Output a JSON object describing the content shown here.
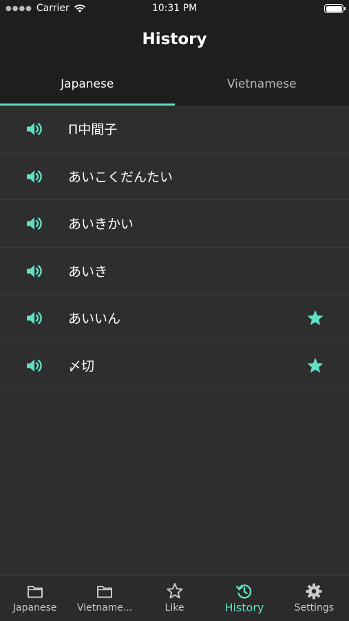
{
  "status_bar": {
    "carrier": "Carrier",
    "time": "10:31 PM"
  },
  "nav": {
    "title": "History"
  },
  "top_tabs": [
    {
      "label": "Japanese",
      "active": true
    },
    {
      "label": "Vietnamese",
      "active": false
    }
  ],
  "history": [
    {
      "word": "Π中間子",
      "starred": false
    },
    {
      "word": "あいこくだんたい",
      "starred": false
    },
    {
      "word": "あいきかい",
      "starred": false
    },
    {
      "word": "あいき",
      "starred": false
    },
    {
      "word": "あいいん",
      "starred": true
    },
    {
      "word": "〆切",
      "starred": true
    }
  ],
  "tab_bar": [
    {
      "label": "Japanese",
      "icon": "folder-icon",
      "active": false
    },
    {
      "label": "Vietname...",
      "icon": "folder-icon",
      "active": false
    },
    {
      "label": "Like",
      "icon": "star-outline-icon",
      "active": false
    },
    {
      "label": "History",
      "icon": "history-icon",
      "active": true
    },
    {
      "label": "Settings",
      "icon": "gear-icon",
      "active": false
    }
  ],
  "colors": {
    "accent": "#5fe0c3",
    "background": "#2e2e2e",
    "bar": "#1e1e1e"
  }
}
